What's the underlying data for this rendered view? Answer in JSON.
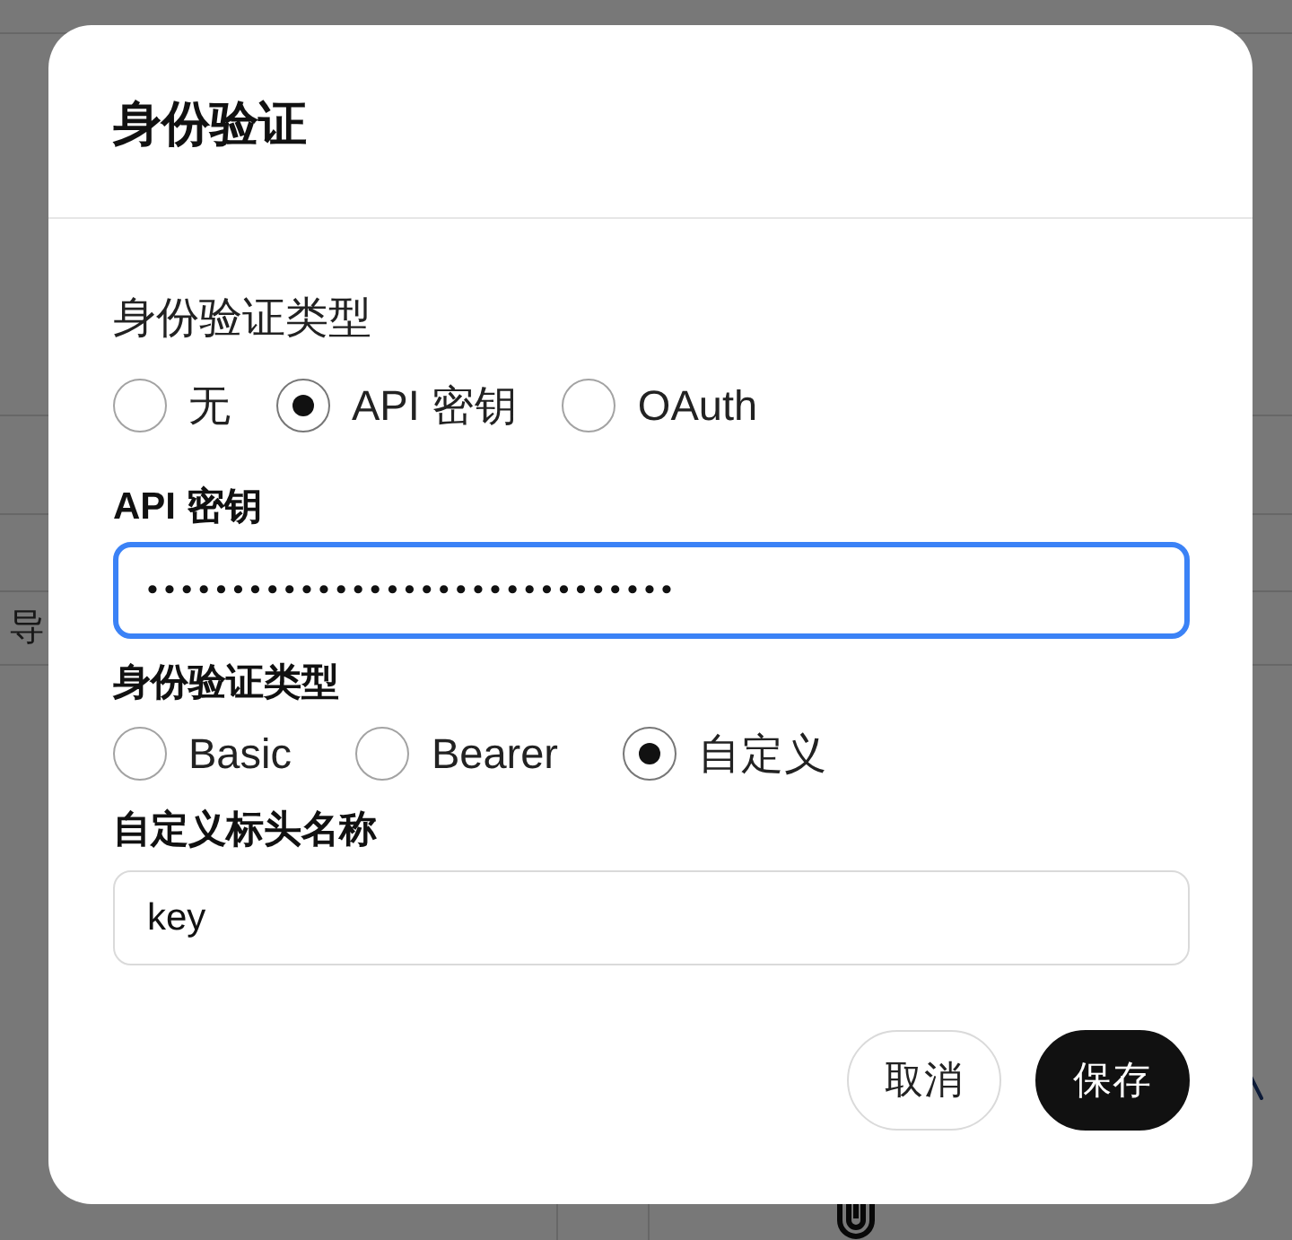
{
  "background_page": {
    "cell_text": "导"
  },
  "dialog": {
    "title": "身份验证",
    "auth_type": {
      "label": "身份验证类型",
      "options": [
        {
          "label": "无",
          "selected": false
        },
        {
          "label": "API 密钥",
          "selected": true
        },
        {
          "label": "OAuth",
          "selected": false
        }
      ]
    },
    "api_key": {
      "label": "API 密钥",
      "value": "•••••••••••••••••••••••••••••••",
      "focused": true
    },
    "key_auth_type": {
      "label": "身份验证类型",
      "options": [
        {
          "label": "Basic",
          "selected": false
        },
        {
          "label": "Bearer",
          "selected": false
        },
        {
          "label": "自定义",
          "selected": true
        }
      ]
    },
    "header_name": {
      "label": "自定义标头名称",
      "value": "key",
      "focused": false
    },
    "buttons": [
      {
        "label": "取消",
        "kind": "secondary"
      },
      {
        "label": "保存",
        "kind": "primary"
      }
    ]
  }
}
